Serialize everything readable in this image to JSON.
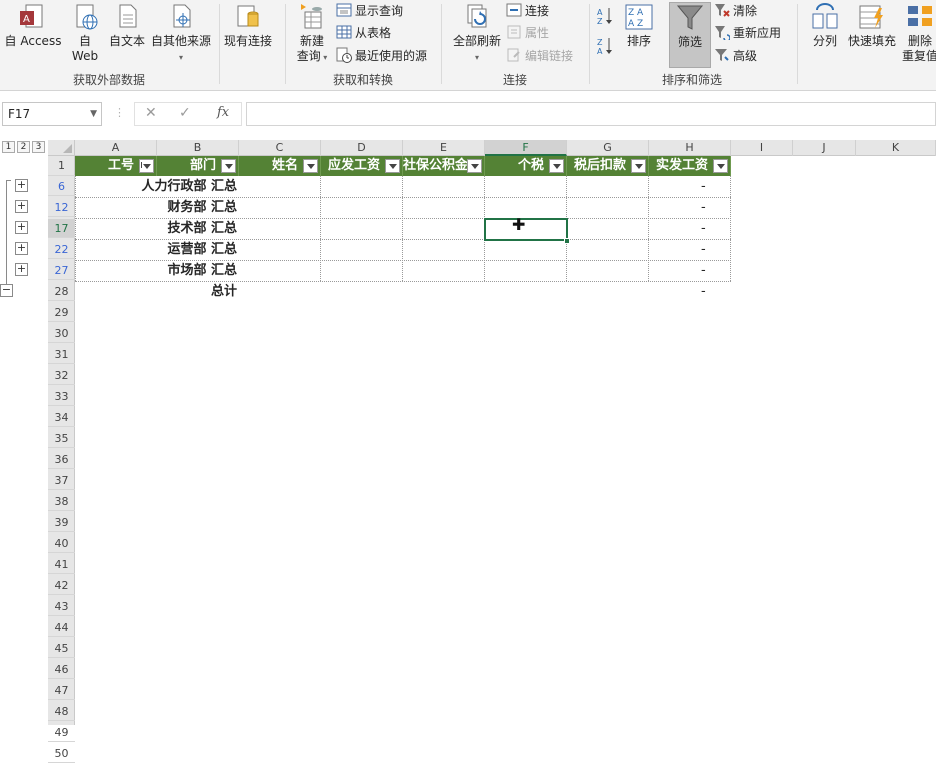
{
  "ribbon": {
    "groups": [
      {
        "label": "获取外部数据",
        "buttons": [
          "自 Access",
          "自\nWeb",
          "自文本",
          "自其他来源"
        ]
      },
      {
        "label": "",
        "buttons": [
          "现有连接"
        ]
      },
      {
        "label": "获取和转换",
        "big": "新建\n查询",
        "small": [
          "显示查询",
          "从表格",
          "最近使用的源"
        ]
      },
      {
        "label": "连接",
        "big": "全部刷新",
        "small": [
          "连接",
          "属性",
          "编辑链接"
        ]
      },
      {
        "label": "排序和筛选",
        "buttons": [
          "排序",
          "筛选"
        ],
        "small": [
          "清除",
          "重新应用",
          "高级"
        ]
      },
      {
        "label": "",
        "buttons": [
          "分列",
          "快速填充",
          "删除\n重复值"
        ]
      }
    ],
    "labels": {
      "access": "自 Access",
      "web1": "自",
      "web2": "Web",
      "text": "自文本",
      "other": "自其他来源",
      "existing": "现有连接",
      "newquery1": "新建",
      "newquery2": "查询",
      "showquery": "显示查询",
      "fromtable": "从表格",
      "recent": "最近使用的源",
      "refreshall": "全部刷新",
      "connections": "连接",
      "properties": "属性",
      "editlinks": "编辑链接",
      "sort": "排序",
      "filter": "筛选",
      "clear": "清除",
      "reapply": "重新应用",
      "advanced": "高级",
      "split": "分列",
      "flashfill": "快速填充",
      "dedup1": "删除",
      "dedup2": "重复值",
      "grp_external": "获取外部数据",
      "grp_transform": "获取和转换",
      "grp_conn": "连接",
      "grp_sortfilter": "排序和筛选"
    }
  },
  "formula_bar": {
    "name_box": "F17",
    "formula": "",
    "cancel": "✕",
    "enter": "✓",
    "fx": "fx"
  },
  "outline": {
    "levels": [
      "1",
      "2",
      "3"
    ],
    "buttons": [
      "+",
      "+",
      "+",
      "+",
      "+",
      "−"
    ]
  },
  "columns": [
    "A",
    "B",
    "C",
    "D",
    "E",
    "F",
    "G",
    "H",
    "I",
    "J",
    "K"
  ],
  "rows": [
    "1",
    "6",
    "12",
    "17",
    "22",
    "27",
    "28",
    "29",
    "30",
    "31",
    "32",
    "33",
    "34",
    "35",
    "36",
    "37",
    "38",
    "39",
    "40",
    "41",
    "42",
    "43",
    "44",
    "45",
    "46",
    "47",
    "48",
    "49",
    "50"
  ],
  "table": {
    "headers": [
      "工号",
      "部门",
      "姓名",
      "应发工资",
      "社保公积金",
      "个税",
      "税后扣款",
      "实发工资"
    ],
    "rows": [
      {
        "dept": "人力行政部 汇总",
        "net": "-"
      },
      {
        "dept": "财务部 汇总",
        "net": "-"
      },
      {
        "dept": "技术部 汇总",
        "net": "-"
      },
      {
        "dept": "运营部 汇总",
        "net": "-"
      },
      {
        "dept": "市场部 汇总",
        "net": "-"
      },
      {
        "dept": "总计",
        "net": "-"
      }
    ]
  },
  "colors": {
    "header_fill": "#548235",
    "selection": "#217346",
    "outline_row": "#3a66d4"
  }
}
